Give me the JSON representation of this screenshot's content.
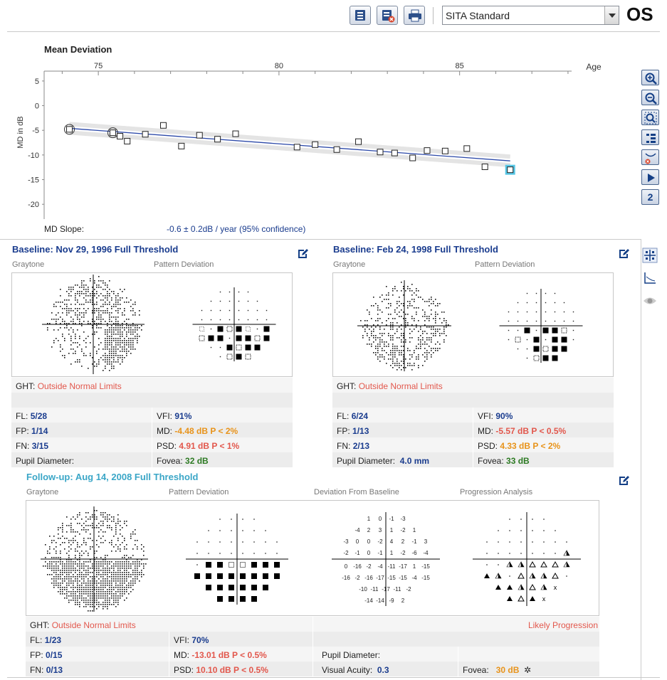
{
  "toolbar": {
    "buttons": [
      "report-icon",
      "report-delete-icon",
      "print-icon"
    ],
    "test_type": "SITA Standard",
    "eye": "OS"
  },
  "chart_data": {
    "type": "scatter",
    "title": "Mean Deviation",
    "xlabel": "Age",
    "ylabel": "MD in dB",
    "xlim": [
      73.5,
      88.1
    ],
    "ylim": [
      -23,
      7
    ],
    "x_ticks": [
      75,
      80,
      85
    ],
    "y_ticks": [
      5,
      0,
      -5,
      -10,
      -15,
      -20
    ],
    "points": [
      {
        "x": 74.2,
        "y": -4.8,
        "baseline": true
      },
      {
        "x": 75.4,
        "y": -5.5,
        "baseline": true
      },
      {
        "x": 75.6,
        "y": -6.2
      },
      {
        "x": 75.8,
        "y": -7.2
      },
      {
        "x": 76.3,
        "y": -5.8
      },
      {
        "x": 76.8,
        "y": -4.0
      },
      {
        "x": 77.3,
        "y": -8.2
      },
      {
        "x": 77.8,
        "y": -6.0
      },
      {
        "x": 78.3,
        "y": -6.8
      },
      {
        "x": 78.8,
        "y": -5.7
      },
      {
        "x": 80.5,
        "y": -8.4
      },
      {
        "x": 81.0,
        "y": -7.9
      },
      {
        "x": 81.6,
        "y": -8.9
      },
      {
        "x": 82.2,
        "y": -7.3
      },
      {
        "x": 82.8,
        "y": -9.4
      },
      {
        "x": 83.2,
        "y": -9.6
      },
      {
        "x": 83.7,
        "y": -10.6
      },
      {
        "x": 84.1,
        "y": -9.1
      },
      {
        "x": 84.6,
        "y": -9.2
      },
      {
        "x": 85.2,
        "y": -8.7
      },
      {
        "x": 85.7,
        "y": -12.4
      },
      {
        "x": 86.4,
        "y": -13.0,
        "selected": true
      }
    ],
    "trend": {
      "x": [
        74.2,
        86.4
      ],
      "y": [
        -4.6,
        -11.2
      ]
    },
    "slope_label": "MD Slope:",
    "slope_text": "-0.6 ± 0.2dB / year (95% confidence)"
  },
  "baseline1": {
    "title": "Baseline: Nov 29, 1996 Full Threshold",
    "gray_label": "Graytone",
    "pd_label": "Pattern Deviation",
    "ght_label": "GHT:",
    "ght": "Outside Normal Limits",
    "fl_l": "FL:",
    "fl": "5/28",
    "fp_l": "FP:",
    "fp": "1/14",
    "fn_l": "FN:",
    "fn": "3/15",
    "pupil_l": "Pupil Diameter:",
    "vfi_l": "VFI:",
    "vfi": "91%",
    "md_l": "MD:",
    "md": "-4.48 dB P < 2%",
    "psd_l": "PSD:",
    "psd": "4.91 dB P < 1%",
    "fovea_l": "Fovea:",
    "fovea": "32 dB"
  },
  "baseline2": {
    "title": "Baseline: Feb 24, 1998 Full Threshold",
    "gray_label": "Graytone",
    "pd_label": "Pattern Deviation",
    "ght_label": "GHT:",
    "ght": "Outside Normal Limits",
    "fl_l": "FL:",
    "fl": "6/24",
    "fp_l": "FP:",
    "fp": "1/13",
    "fn_l": "FN:",
    "fn": "2/13",
    "pupil_l": "Pupil Diameter:",
    "pupil": "4.0 mm",
    "vfi_l": "VFI:",
    "vfi": "90%",
    "md_l": "MD:",
    "md": "-5.57 dB P < 0.5%",
    "psd_l": "PSD:",
    "psd": "4.33 dB P < 2%",
    "fovea_l": "Fovea:",
    "fovea": "33 dB"
  },
  "followup": {
    "title": "Follow-up: Aug 14, 2008 Full Threshold",
    "gray_label": "Graytone",
    "pd_label": "Pattern Deviation",
    "dev_label": "Deviation From Baseline",
    "prog_label": "Progression Analysis",
    "ght_label": "GHT:",
    "ght": "Outside Normal Limits",
    "progression": "Likely Progression",
    "fl_l": "FL:",
    "fl": "1/23",
    "fp_l": "FP:",
    "fp": "0/15",
    "fn_l": "FN:",
    "fn": "0/13",
    "vfi_l": "VFI:",
    "vfi": "70%",
    "md_l": "MD:",
    "md": "-13.01 dB P < 0.5%",
    "psd_l": "PSD:",
    "psd": "10.10 dB P < 0.5%",
    "pupil_l": "Pupil Diameter:",
    "va_l": "Visual Acuity:",
    "va": "0.3",
    "fovea_l": "Fovea:",
    "fovea": "30 dB",
    "deviation_rows": [
      [
        "1",
        "0",
        "-1",
        "-3"
      ],
      [
        "-4",
        "2",
        "3",
        "1",
        "-2",
        "1"
      ],
      [
        "-3",
        "0",
        "0",
        "-2",
        "4",
        "2",
        "-1",
        "3"
      ],
      [
        "-2",
        "-1",
        "0",
        "-1",
        "1",
        "-2",
        "-6",
        "-4"
      ],
      [
        "0",
        "-16",
        "-2",
        "-4",
        "-11",
        "-17",
        "1",
        "-15"
      ],
      [
        "-16",
        "-2",
        "-16",
        "-17",
        "-15",
        "-15",
        "-4",
        "-15"
      ],
      [
        "-10",
        "-11",
        "-17",
        "-11",
        "-2"
      ],
      [
        "-14",
        "-14",
        "-9",
        "2"
      ]
    ]
  }
}
